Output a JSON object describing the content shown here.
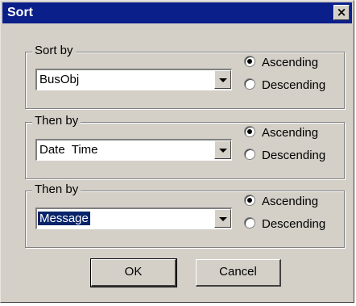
{
  "window": {
    "title": "Sort",
    "close_label": "×"
  },
  "groups": [
    {
      "label": "Sort by",
      "value": "BusObj",
      "selected": false,
      "ascending": "Ascending",
      "descending": "Descending",
      "checked": "ascending"
    },
    {
      "label": "Then by",
      "value": "Date  Time",
      "selected": false,
      "ascending": "Ascending",
      "descending": "Descending",
      "checked": "ascending"
    },
    {
      "label": "Then by",
      "value": "Message",
      "selected": true,
      "ascending": "Ascending",
      "descending": "Descending",
      "checked": "ascending"
    }
  ],
  "buttons": {
    "ok": "OK",
    "cancel": "Cancel"
  },
  "colors": {
    "titlebar": "#0b1f8a",
    "face": "#d4d0c8",
    "selection": "#0a246a"
  }
}
